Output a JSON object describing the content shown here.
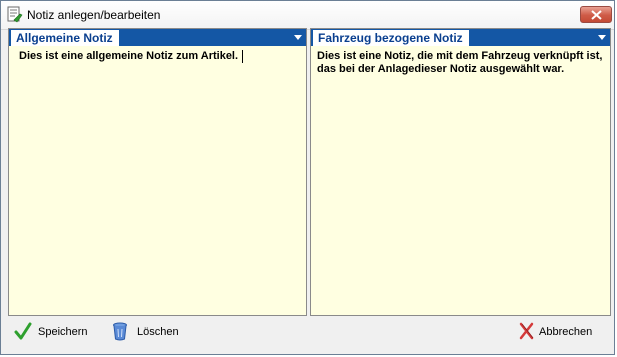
{
  "window": {
    "title": "Notiz anlegen/bearbeiten",
    "close_icon": "close-icon",
    "title_icon": "note-edit-icon"
  },
  "panels": {
    "general": {
      "header": "Allgemeine Notiz",
      "text": "Dies ist eine allgemeine Notiz zum Artikel."
    },
    "vehicle": {
      "header": "Fahrzeug bezogene Notiz",
      "text": "Dies ist eine Notiz, die mit dem Fahrzeug verknüpft ist,\ndas bei der Anlagedieser Notiz ausgewählt war."
    }
  },
  "buttons": {
    "save": "Speichern",
    "delete": "Löschen",
    "cancel": "Abbrechen"
  },
  "colors": {
    "panel_header": "#1457a5",
    "panel_background": "#ffffe1",
    "header_text": "#0a3f8f",
    "close_button": "#cf5b47"
  }
}
